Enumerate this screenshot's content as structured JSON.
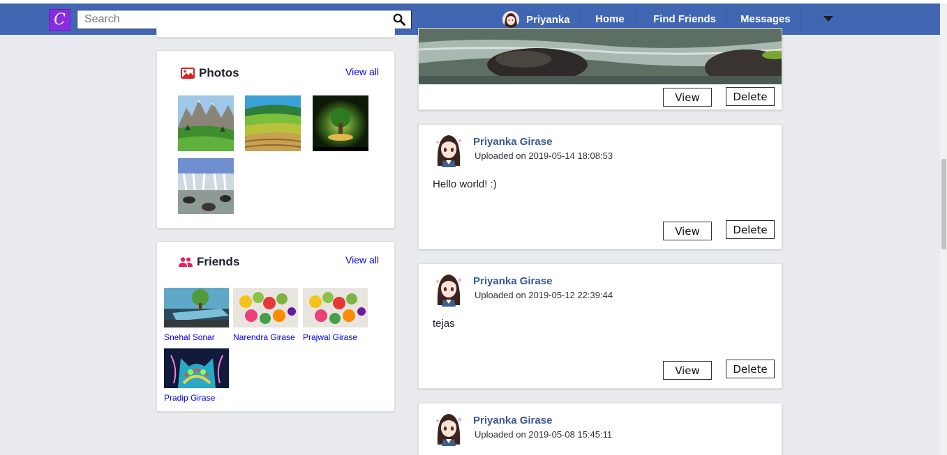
{
  "app": {
    "logo_letter": "C"
  },
  "search": {
    "placeholder": "Search",
    "value": ""
  },
  "nav": {
    "user_name": "Priyanka",
    "home": "Home",
    "find_friends": "Find Friends",
    "messages": "Messages"
  },
  "photos_card": {
    "title": "Photos",
    "view_all": "View all",
    "photos": [
      "mountain-meadow",
      "rice-terraces",
      "glowing-tree",
      "waterfall"
    ]
  },
  "friends_card": {
    "title": "Friends",
    "view_all": "View all",
    "friends": [
      {
        "name": "Snehal Sonar"
      },
      {
        "name": "Narendra Girase"
      },
      {
        "name": "Prajwal Girase"
      },
      {
        "name": "Pradip Girase"
      }
    ]
  },
  "posts": [
    {
      "author": "",
      "date": "",
      "text": "",
      "image": "river-rocks",
      "view_label": "View",
      "delete_label": "Delete"
    },
    {
      "author": "Priyanka Girase",
      "date": "Uploaded on 2019-05-14 18:08:53",
      "text": "Hello world! :)",
      "view_label": "View",
      "delete_label": "Delete"
    },
    {
      "author": "Priyanka Girase",
      "date": "Uploaded on 2019-05-12 22:39:44",
      "text": "tejas",
      "view_label": "View",
      "delete_label": "Delete"
    },
    {
      "author": "Priyanka Girase",
      "date": "Uploaded on 2019-05-08 15:45:11",
      "text": ""
    }
  ],
  "colors": {
    "navbar": "#4267b2",
    "logo": "#8a2be2",
    "author_link": "#385898",
    "link_blue": "#0000ee",
    "photos_icon": "#e02020",
    "friends_icon": "#e91e63"
  }
}
